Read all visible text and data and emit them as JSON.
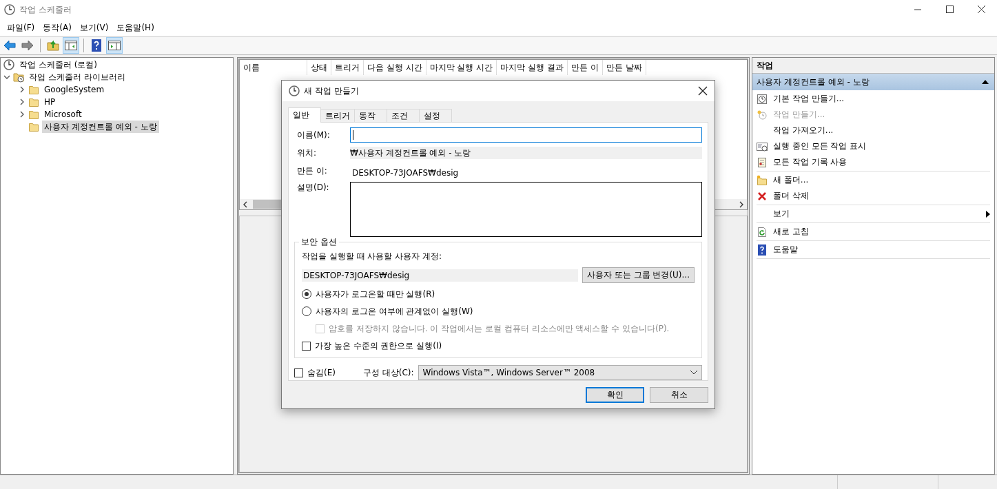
{
  "window": {
    "title": "작업 스케줄러"
  },
  "menu": [
    "파일(F)",
    "동작(A)",
    "보기(V)",
    "도움말(H)"
  ],
  "toolbar": [
    {
      "pressed": false
    },
    {
      "pressed": false
    },
    {
      "pressed": false
    },
    {
      "pressed": true
    },
    {
      "pressed": false
    },
    {
      "pressed": true
    }
  ],
  "tree": [
    {
      "label": "작업 스케줄러 (로컬)",
      "selected": false,
      "children": [
        {
          "label": "작업 스케줄러 라이브러리",
          "expanded": true,
          "selected": false,
          "children": [
            {
              "label": "GoogleSystem",
              "expanded": false,
              "selected": false
            },
            {
              "label": "HP",
              "expanded": false,
              "selected": false
            },
            {
              "label": "Microsoft",
              "expanded": false,
              "selected": false
            },
            {
              "label": "사용자 계정컨트롤 예외 - 노랑",
              "selected": true
            }
          ]
        }
      ]
    }
  ],
  "task_list": {
    "columns": [
      "이름",
      "상태",
      "트리거",
      "다음 실행 시간",
      "마지막 실행 시간",
      "마지막 실행 결과",
      "만든 이",
      "만든 날짜"
    ]
  },
  "actions": {
    "title": "작업",
    "section": "사용자 계정컨트롤 예외 - 노랑",
    "groups": [
      [
        {
          "label": "기본 작업 만들기...",
          "disabled": false
        },
        {
          "label": "작업 만들기...",
          "disabled": true
        },
        {
          "label": "작업 가져오기...",
          "disabled": false
        },
        {
          "label": "실행 중인 모든 작업 표시",
          "disabled": false
        },
        {
          "label": "모든 작업 기록 사용",
          "disabled": false
        }
      ],
      [
        {
          "label": "새 폴더...",
          "disabled": false
        },
        {
          "label": "폴더 삭제",
          "disabled": false
        }
      ],
      [
        {
          "label": "보기",
          "disabled": false
        }
      ],
      [
        {
          "label": "새로 고침",
          "disabled": false
        }
      ],
      [
        {
          "label": "도움말",
          "disabled": false
        }
      ]
    ]
  },
  "dialog": {
    "title": "새 작업 만들기",
    "tabs": [
      {
        "label": "일반",
        "selected": true
      },
      {
        "label": "트리거",
        "selected": false
      },
      {
        "label": "동작",
        "selected": false
      },
      {
        "label": "조건",
        "selected": false
      },
      {
        "label": "설정",
        "selected": false
      }
    ],
    "name_label": "이름(M):",
    "location_label": "위치:",
    "location": "₩사용자 계정컨트롤 예외 - 노랑",
    "author_label": "만든 이:",
    "author": "DESKTOP-73JOAFS₩desig",
    "description_label": "설명(D):",
    "security": {
      "title": "보안 옵션",
      "account_label": "작업을 실행할 때 사용할 사용자 계정:",
      "account": "DESKTOP-73JOAFS₩desig",
      "change_button": "사용자 또는 그룹 변경(U)...",
      "options": [
        {
          "kind": "radio",
          "label": "사용자가 로그온할 때만 실행(R)",
          "selected": true
        },
        {
          "kind": "radio",
          "label": "사용자의 로그온 여부에 관계없이 실행(W)",
          "selected": false,
          "children": [
            {
              "kind": "checkbox",
              "label": "암호를 저장하지 않습니다. 이 작업에서는 로컬 컴퓨터 리소스에만 액세스할 수 있습니다(P).",
              "checked": false,
              "disabled": true
            }
          ]
        },
        {
          "kind": "checkbox",
          "label": "가장 높은 수준의 권한으로 실행(I)",
          "checked": false,
          "disabled": false
        }
      ]
    },
    "hidden": {
      "label": "숨김(E)",
      "checked": false
    },
    "configure_label": "구성 대상(C):",
    "configure_value": "Windows Vista™, Windows Server™ 2008",
    "buttons": [
      {
        "label": "확인",
        "default": true
      },
      {
        "label": "취소",
        "default": false
      }
    ]
  }
}
